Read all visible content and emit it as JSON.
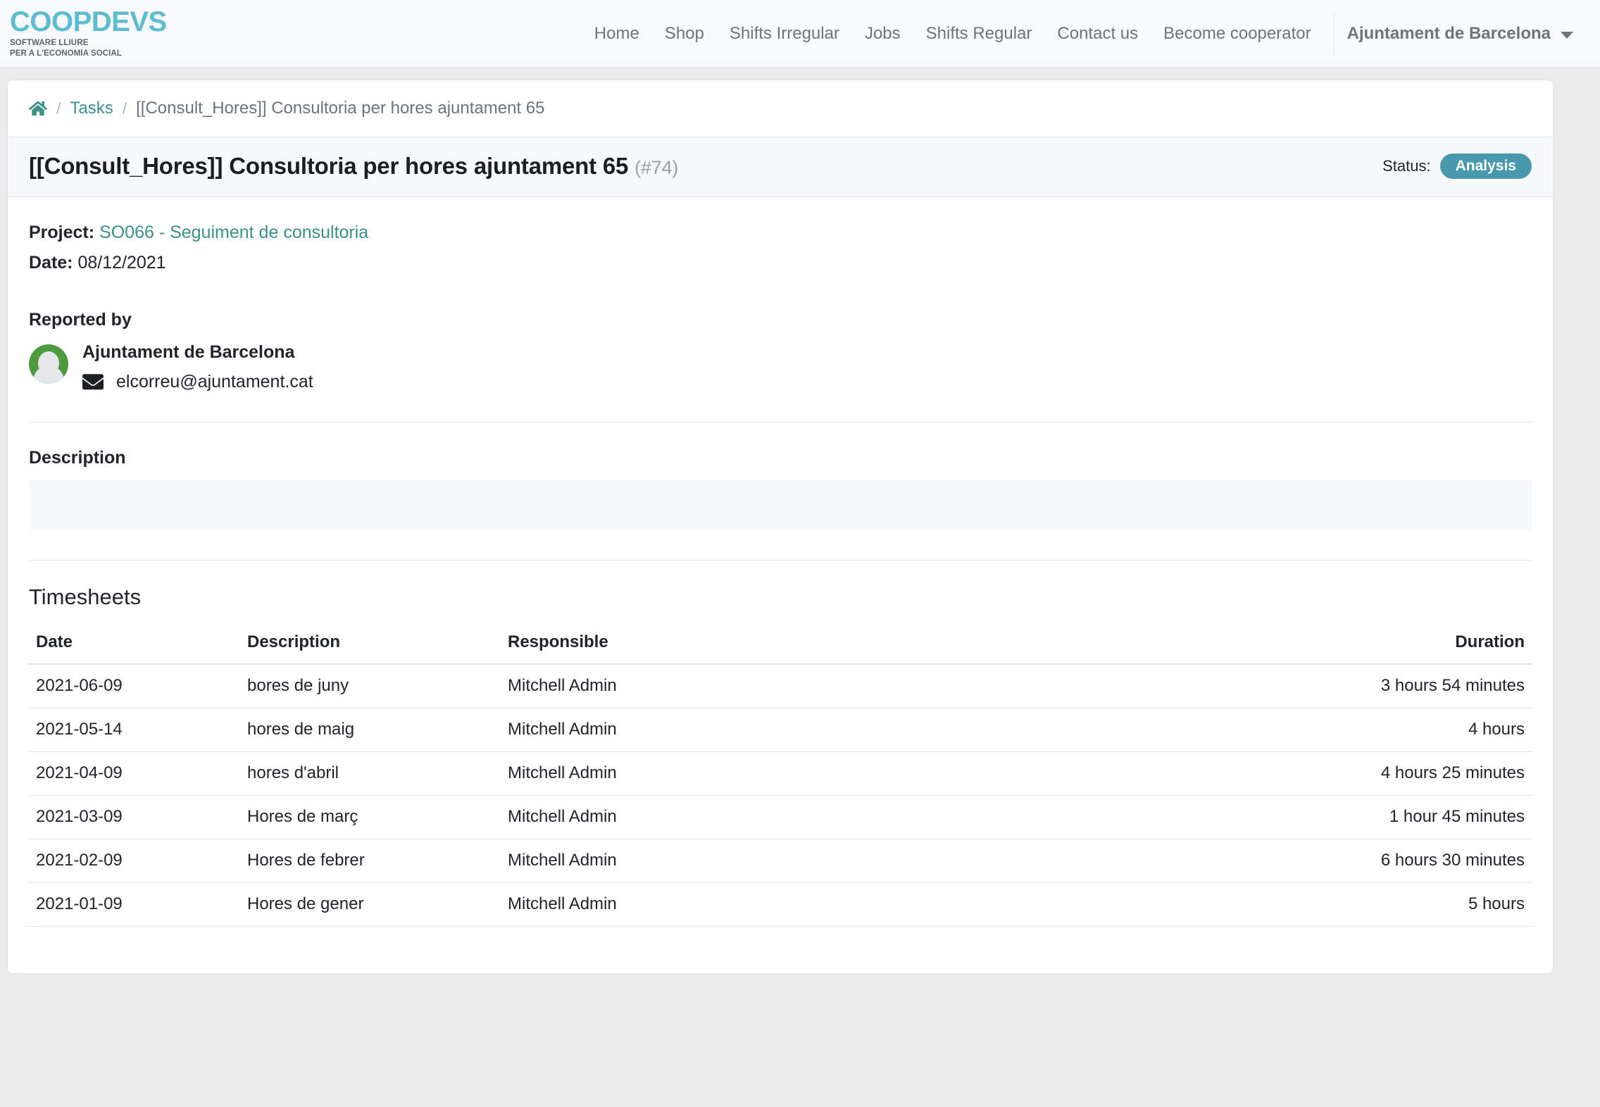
{
  "navbar": {
    "brand": {
      "word": "COOPDEVS",
      "line1": "SOFTWARE LLIURE",
      "line2": "PER A L'ECONOMIA SOCIAL"
    },
    "links": [
      {
        "label": "Home"
      },
      {
        "label": "Shop"
      },
      {
        "label": "Shifts Irregular"
      },
      {
        "label": "Jobs"
      },
      {
        "label": "Shifts Regular"
      },
      {
        "label": "Contact us"
      },
      {
        "label": "Become cooperator"
      }
    ],
    "user": "Ajuntament de Barcelona"
  },
  "breadcrumb": {
    "home_icon": "home-icon",
    "separator": "/",
    "tasks": "Tasks",
    "current": "[[Consult_Hores]] Consultoria per hores ajuntament 65"
  },
  "header": {
    "title": "[[Consult_Hores]] Consultoria per hores ajuntament 65",
    "id": "(#74)",
    "status_label": "Status:",
    "status_value": "Analysis",
    "status_color": "#4899ad"
  },
  "details": {
    "project_label": "Project:",
    "project_value": "SO066 - Seguiment de consultoria",
    "date_label": "Date:",
    "date_value": "08/12/2021",
    "reported_by_label": "Reported by",
    "reporter_name": "Ajuntament de Barcelona",
    "reporter_email": "elcorreu@ajuntament.cat",
    "avatar_color": "#4e9b3f"
  },
  "description": {
    "title": "Description",
    "content": ""
  },
  "timesheets": {
    "title": "Timesheets",
    "columns": [
      "Date",
      "Description",
      "Responsible",
      "Duration"
    ],
    "rows": [
      {
        "date": "2021-06-09",
        "description": "bores de juny",
        "responsible": "Mitchell Admin",
        "duration": "3 hours 54 minutes"
      },
      {
        "date": "2021-05-14",
        "description": "hores de maig",
        "responsible": "Mitchell Admin",
        "duration": "4 hours"
      },
      {
        "date": "2021-04-09",
        "description": "hores d'abril",
        "responsible": "Mitchell Admin",
        "duration": "4 hours 25 minutes"
      },
      {
        "date": "2021-03-09",
        "description": "Hores de març",
        "responsible": "Mitchell Admin",
        "duration": "1 hour 45 minutes"
      },
      {
        "date": "2021-02-09",
        "description": "Hores de febrer",
        "responsible": "Mitchell Admin",
        "duration": "6 hours 30 minutes"
      },
      {
        "date": "2021-01-09",
        "description": "Hores de gener",
        "responsible": "Mitchell Admin",
        "duration": "5 hours"
      }
    ]
  }
}
